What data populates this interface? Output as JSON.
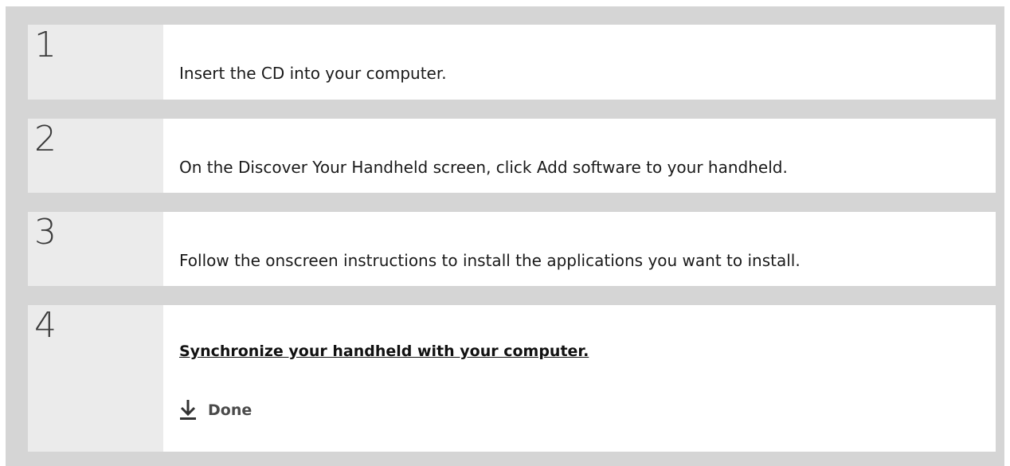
{
  "steps": [
    {
      "number": "1",
      "text": "Insert the CD into your computer."
    },
    {
      "number": "2",
      "text": "On the Discover Your Handheld screen, click Add software to your handheld."
    },
    {
      "number": "3",
      "text": "Follow the onscreen instructions to install the applications you want to install."
    },
    {
      "number": "4",
      "link_text": "Synchronize your handheld with your computer.",
      "done_label": "Done",
      "done_icon": "down-arrow-icon"
    }
  ]
}
